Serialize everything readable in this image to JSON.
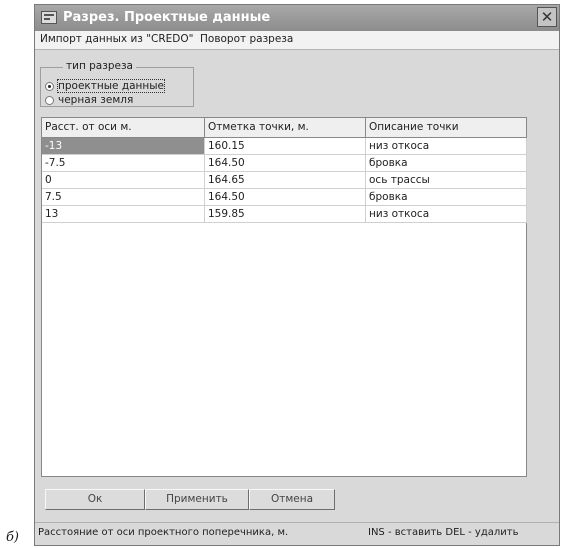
{
  "window": {
    "title": "Разрез. Проектные данные",
    "close_symbol": "✕"
  },
  "menu": {
    "items": [
      "Импорт данных из \"CREDO\"",
      "Поворот разреза"
    ]
  },
  "section_type": {
    "legend": "тип разреза",
    "options": [
      {
        "label": "проектные данные",
        "selected": true
      },
      {
        "label": "черная земля",
        "selected": false
      }
    ]
  },
  "table": {
    "headers": [
      "Расст. от оси  м.",
      "Отметка точки, м.",
      "Описание точки"
    ],
    "rows": [
      [
        "-13",
        "160.15",
        "низ откоса"
      ],
      [
        "-7.5",
        "164.50",
        "бровка"
      ],
      [
        "0",
        "164.65",
        "ось трассы"
      ],
      [
        "7.5",
        "164.50",
        "бровка"
      ],
      [
        "13",
        "159.85",
        "низ откоса"
      ]
    ]
  },
  "buttons": {
    "ok": "Ок",
    "apply": "Применить",
    "cancel": "Отмена"
  },
  "status": {
    "left": "Расстояние от оси проектного поперечника, м.",
    "right": "INS - вставить DEL - удалить"
  },
  "caption": "б)",
  "colors": {
    "titlebar": "#999999",
    "selected_cell": "#8f8f8f",
    "window_bg": "#d9d9d9"
  },
  "icons": {
    "title": "window-app-icon",
    "close": "close-icon"
  }
}
